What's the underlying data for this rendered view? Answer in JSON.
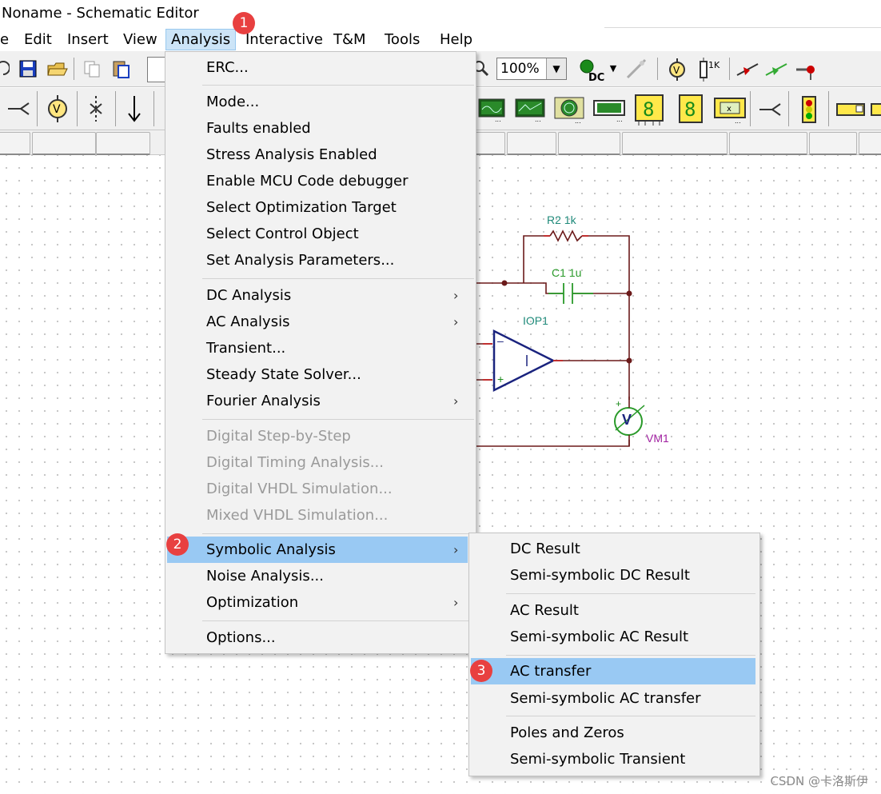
{
  "window": {
    "title": "Noname - Schematic Editor"
  },
  "menubar": {
    "items": [
      {
        "label": "e"
      },
      {
        "label": "Edit"
      },
      {
        "label": "Insert"
      },
      {
        "label": "View"
      },
      {
        "label": "Analysis"
      },
      {
        "label": "Interactive"
      },
      {
        "label": "T&M"
      },
      {
        "label": "Tools"
      },
      {
        "label": "Help"
      }
    ]
  },
  "toolbar": {
    "zoom": "100%",
    "dc_label": "DC"
  },
  "schematic": {
    "r2_label": "R2 1k",
    "c1_label": "C1 1u",
    "opamp_label": "IOP1",
    "opamp_minus": "–",
    "opamp_plus": "+",
    "voltmeter_label": "VM1",
    "voltmeter_glyph": "V",
    "voltmeter_plus": "+"
  },
  "analysis_menu": {
    "items": [
      {
        "label": "ERC...",
        "enabled": true,
        "submenu": false
      },
      {
        "label": "Mode...",
        "enabled": true,
        "submenu": false
      },
      {
        "label": "Faults enabled",
        "enabled": true,
        "submenu": false
      },
      {
        "label": "Stress Analysis Enabled",
        "enabled": true,
        "submenu": false
      },
      {
        "label": "Enable MCU Code debugger",
        "enabled": true,
        "submenu": false
      },
      {
        "label": "Select Optimization Target",
        "enabled": true,
        "submenu": false
      },
      {
        "label": "Select Control Object",
        "enabled": true,
        "submenu": false
      },
      {
        "label": "Set Analysis Parameters...",
        "enabled": true,
        "submenu": false
      },
      {
        "label": "DC Analysis",
        "enabled": true,
        "submenu": true
      },
      {
        "label": "AC Analysis",
        "enabled": true,
        "submenu": true
      },
      {
        "label": "Transient...",
        "enabled": true,
        "submenu": false
      },
      {
        "label": "Steady State Solver...",
        "enabled": true,
        "submenu": false
      },
      {
        "label": "Fourier Analysis",
        "enabled": true,
        "submenu": true
      },
      {
        "label": "Digital Step-by-Step",
        "enabled": false,
        "submenu": false
      },
      {
        "label": "Digital Timing Analysis...",
        "enabled": false,
        "submenu": false
      },
      {
        "label": "Digital VHDL Simulation...",
        "enabled": false,
        "submenu": false
      },
      {
        "label": "Mixed VHDL Simulation...",
        "enabled": false,
        "submenu": false
      },
      {
        "label": "Symbolic Analysis",
        "enabled": true,
        "submenu": true,
        "highlighted": true
      },
      {
        "label": "Noise Analysis...",
        "enabled": true,
        "submenu": false
      },
      {
        "label": "Optimization",
        "enabled": true,
        "submenu": true
      },
      {
        "label": "Options...",
        "enabled": true,
        "submenu": false
      }
    ]
  },
  "symbolic_submenu": {
    "items": [
      {
        "label": "DC Result"
      },
      {
        "label": "Semi-symbolic DC Result"
      },
      {
        "label": "AC Result"
      },
      {
        "label": "Semi-symbolic AC Result"
      },
      {
        "label": "AC transfer",
        "highlighted": true
      },
      {
        "label": "Semi-symbolic AC transfer"
      },
      {
        "label": "Poles and Zeros"
      },
      {
        "label": "Semi-symbolic Transient"
      }
    ]
  },
  "badges": [
    "1",
    "2",
    "3"
  ],
  "watermark": "CSDN @卡洛斯伊",
  "colors": {
    "menu_highlight": "#99c9f3",
    "badge": "#e84040",
    "wire": "#6b1a1a",
    "component_label": "#1f8a7a",
    "voltmeter_label": "#a020a0"
  }
}
